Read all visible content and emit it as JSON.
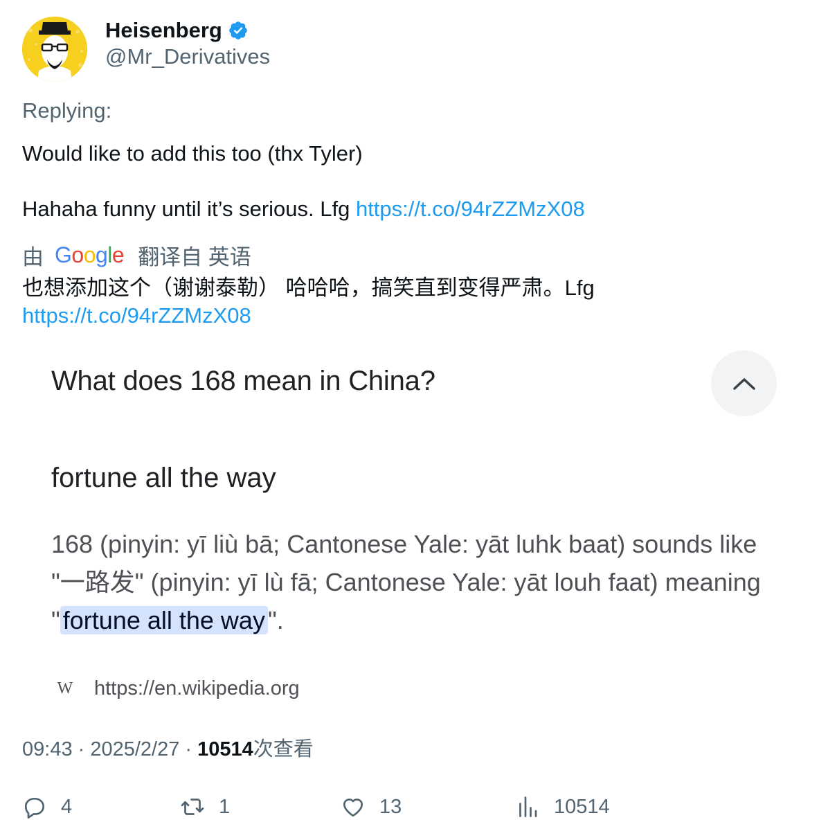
{
  "author": {
    "name": "Heisenberg",
    "handle": "@Mr_Derivatives"
  },
  "replying_label": "Replying:",
  "tweet": {
    "line1": "Would like to add this too (thx Tyler)",
    "line2_text": "Hahaha funny until it’s serious. Lfg ",
    "line2_link": "https://t.co/94rZZMzX08"
  },
  "translation": {
    "by_label": "由",
    "google_letters": [
      "G",
      "o",
      "o",
      "g",
      "l",
      "e"
    ],
    "from_label": "翻译自 英语",
    "text": "也想添加这个（谢谢泰勒） 哈哈哈，搞笑直到变得严肃。Lfg",
    "link": "https://t.co/94rZZMzX08"
  },
  "card": {
    "question": "What does 168 mean in China?",
    "answer": "fortune all the way",
    "snippet_before": "168 (pinyin: yī liù bā; Cantonese Yale: yāt luhk baat) sounds like \"一路发\" (pinyin: yī lù fā; Cantonese Yale: yāt louh faat) meaning \"",
    "snippet_highlight": "fortune all the way",
    "snippet_after": "\".",
    "source_icon_text": "W",
    "source_url": "https://en.wikipedia.org"
  },
  "meta": {
    "time_date": "09:43 · 2025/2/27 · ",
    "views_count": "10514",
    "views_label": "次查看"
  },
  "actions": {
    "replies": "4",
    "retweets": "1",
    "likes": "13",
    "views": "10514"
  },
  "colors": {
    "link": "#1d9bf0",
    "muted": "#536471",
    "verified": "#1d9bf0",
    "highlight": "#d3e3fd"
  }
}
